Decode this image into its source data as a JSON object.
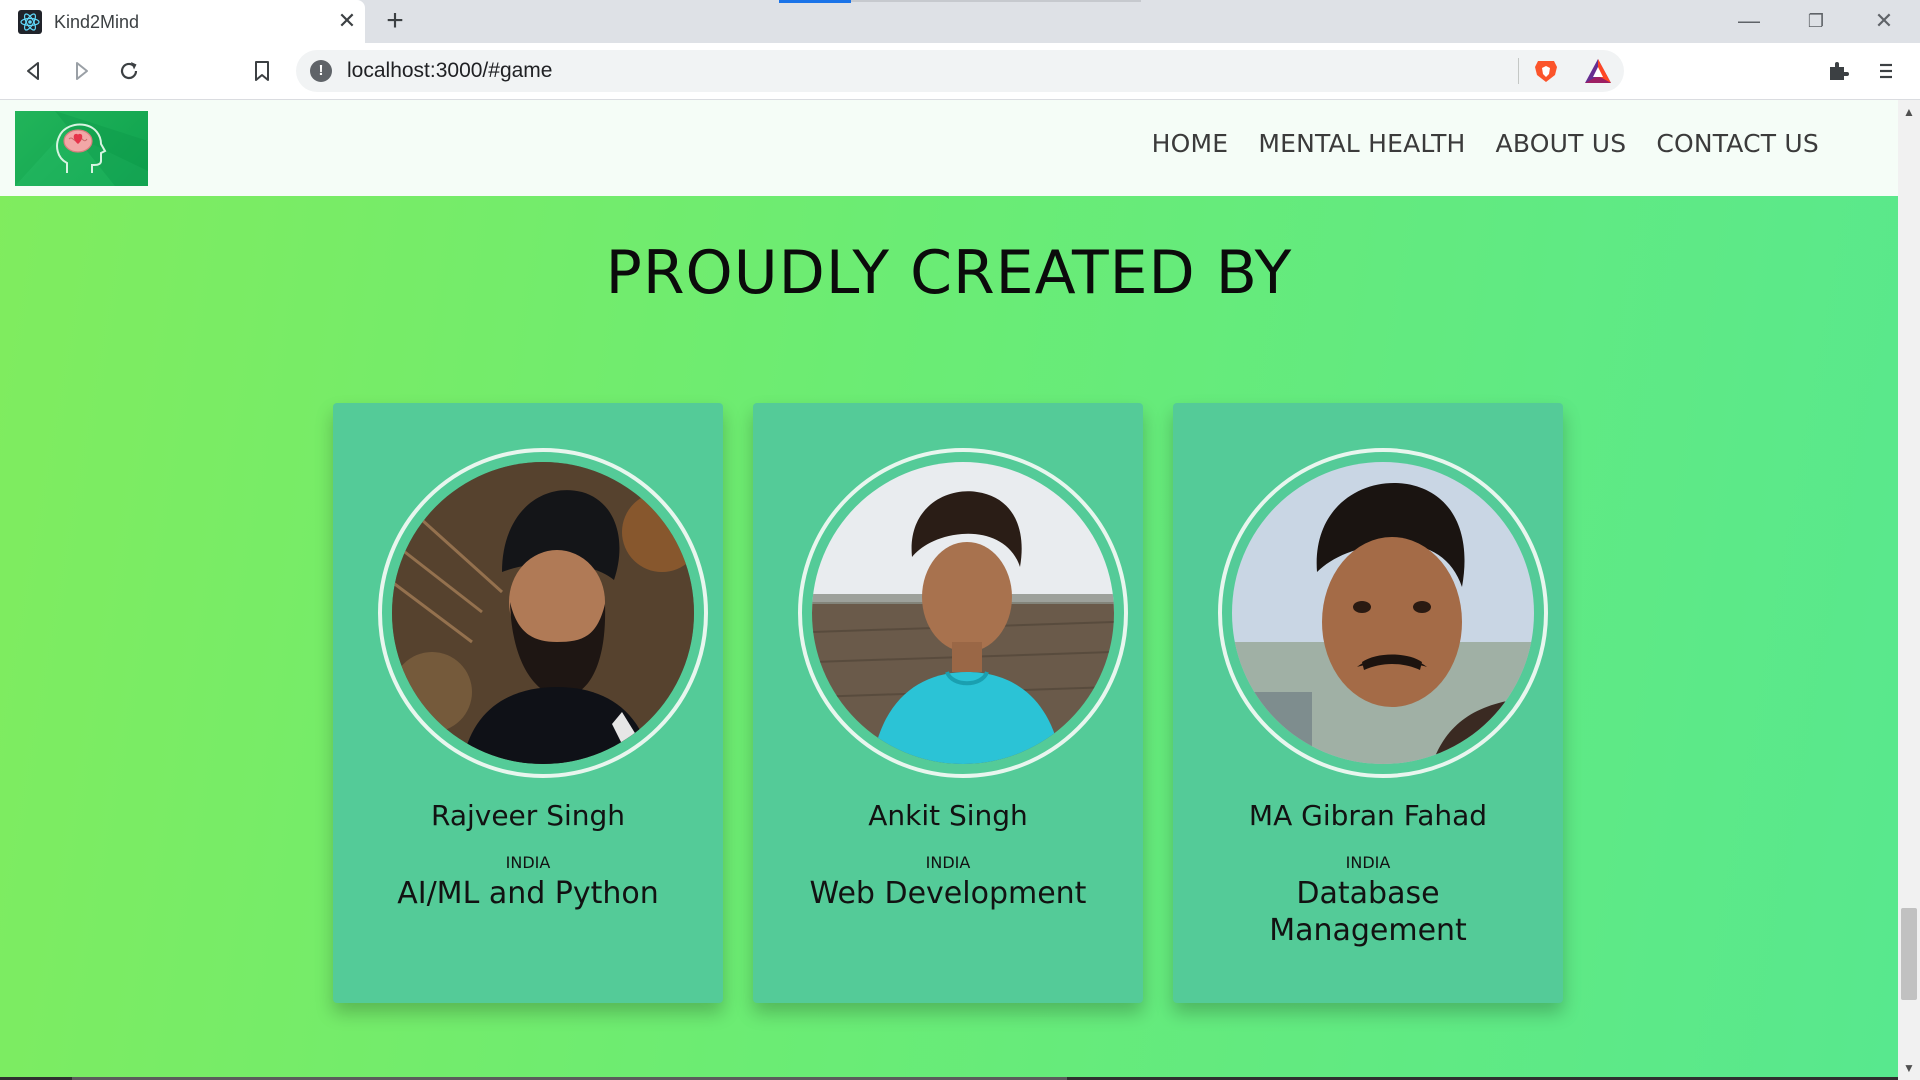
{
  "browser": {
    "tab_title": "Kind2Mind",
    "tab_close": "✕",
    "new_tab": "+",
    "url": "localhost:3000/#game",
    "window_minimize": "—",
    "window_restore": "❐",
    "window_close": "✕",
    "icons": {
      "back": "back-arrow-icon",
      "forward": "forward-arrow-icon",
      "reload": "reload-icon",
      "bookmark": "bookmark-icon",
      "site_info": "info-icon",
      "brave_shields": "brave-lion-icon",
      "brave_rewards": "bat-triangle-icon",
      "extensions": "puzzle-icon",
      "menu": "hamburger-menu-icon"
    }
  },
  "site": {
    "logo_alt": "Kind2Mind logo",
    "nav": {
      "home": "HOME",
      "mental_health": "MENTAL HEALTH",
      "about_us": "ABOUT US",
      "contact_us": "CONTACT US"
    },
    "section_title": "PROUDLY CREATED BY",
    "members": [
      {
        "name": "Rajveer Singh",
        "country": "INDIA",
        "role": "AI/ML and Python"
      },
      {
        "name": "Ankit Singh",
        "country": "INDIA",
        "role": "Web Development"
      },
      {
        "name": "MA Gibran Fahad",
        "country": "INDIA",
        "role": "Database Management"
      }
    ]
  },
  "colors": {
    "page_gradient_start": "#80ec5e",
    "page_gradient_end": "#58e88e",
    "card_bg": "#54cb98",
    "nav_bg": "#f5fdf7",
    "logo_bg": "#1aad55"
  },
  "scrollbar": {
    "up": "▲",
    "down": "▼"
  }
}
